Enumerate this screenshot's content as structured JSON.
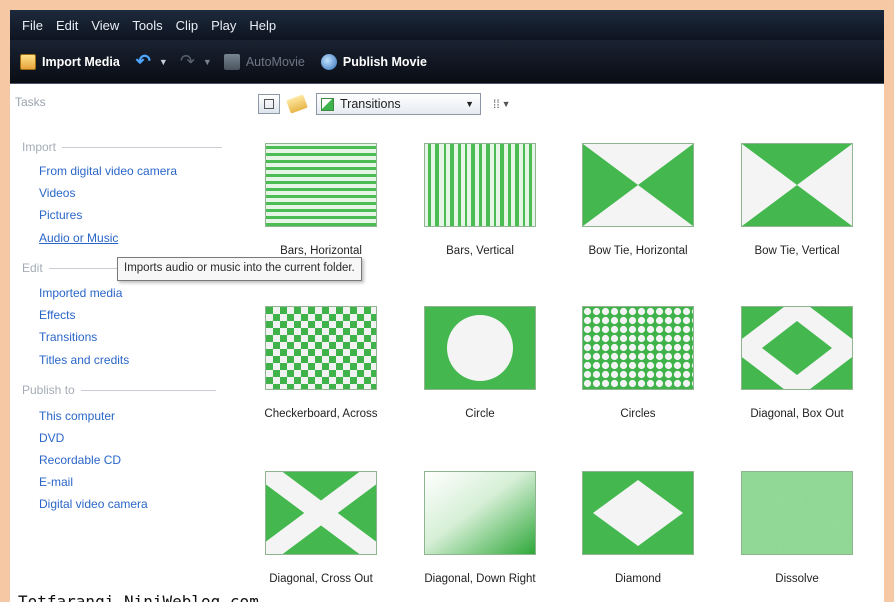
{
  "menu": [
    "File",
    "Edit",
    "View",
    "Tools",
    "Clip",
    "Play",
    "Help"
  ],
  "toolbar": {
    "import_media": "Import Media",
    "automovie": "AutoMovie",
    "publish_movie": "Publish Movie"
  },
  "tasks": {
    "title": "Tasks",
    "import": {
      "heading": "Import",
      "items": [
        "From digital video camera",
        "Videos",
        "Pictures",
        "Audio or Music"
      ]
    },
    "edit": {
      "heading": "Edit",
      "items": [
        "Imported media",
        "Effects",
        "Transitions",
        "Titles and credits"
      ]
    },
    "publish": {
      "heading": "Publish to",
      "items": [
        "This computer",
        "DVD",
        "Recordable CD",
        "E-mail",
        "Digital video camera"
      ]
    }
  },
  "tooltip": "Imports audio or music into the current folder.",
  "content_toolbar": {
    "collection": "Transitions"
  },
  "transitions": [
    "Bars, Horizontal",
    "Bars, Vertical",
    "Bow Tie, Horizontal",
    "Bow Tie, Vertical",
    "Checkerboard, Across",
    "Circle",
    "Circles",
    "Diagonal, Box Out",
    "Diagonal, Cross Out",
    "Diagonal, Down Right",
    "Diamond",
    "Dissolve"
  ],
  "watermark": "Totfarangi.NiniWeblog.com",
  "colors": {
    "accent_green": "#3cb44b",
    "link_blue": "#2a66c8",
    "toolbar_bg": "#0e1420"
  }
}
